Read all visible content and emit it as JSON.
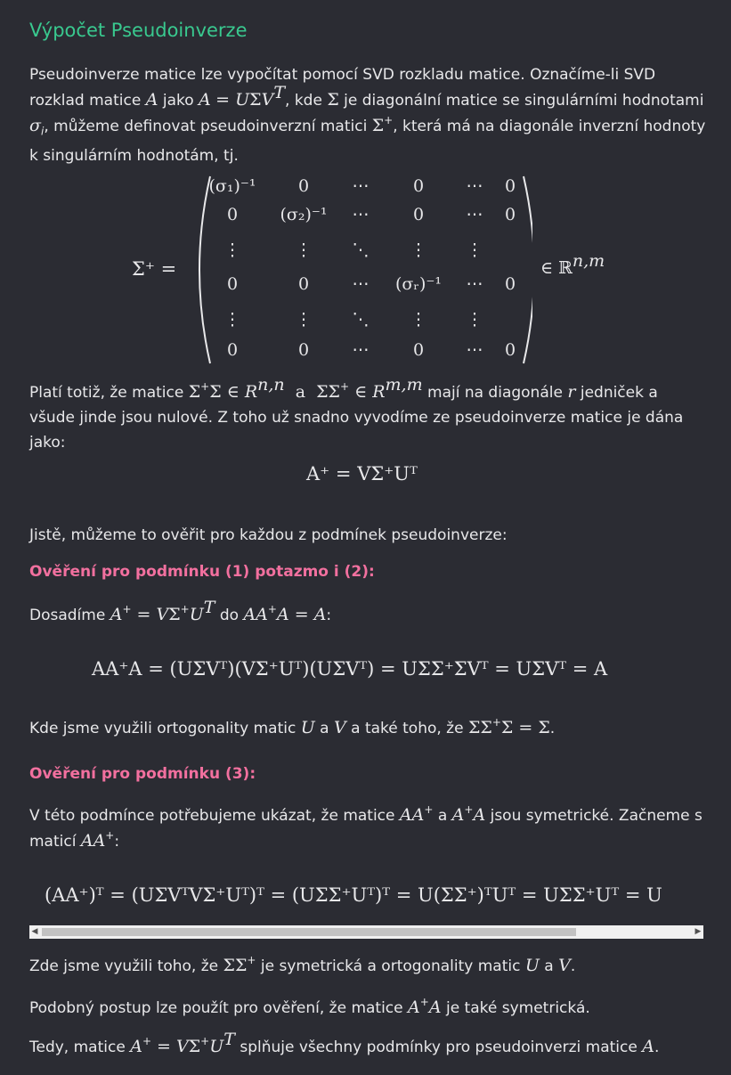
{
  "title": "Výpočet Pseudoinverze",
  "intro": {
    "t1": "Pseudoinverze matice lze vypočítat pomocí SVD rozkladu matice. Označíme-li SVD rozklad matice ",
    "t2": " jako ",
    "t3": ", kde ",
    "t4": " je diagonální matice se singulárními hodnotami ",
    "t5": ", můžeme definovat pseudoinverzní matici ",
    "t6": ", která má na diagonále inverzní hodnoty k singulárním hodnotám, tj."
  },
  "matrix": {
    "lhs": "Σ⁺ =",
    "rhs": "∈ ℝ",
    "rhs_sup": "n,m",
    "rows": [
      [
        "(σ₁)⁻¹",
        "0",
        "⋯",
        "0",
        "⋯",
        "0"
      ],
      [
        "0",
        "(σ₂)⁻¹",
        "⋯",
        "0",
        "⋯",
        "0"
      ],
      [
        "⋮",
        "⋮",
        "⋱",
        "⋮",
        "⋮",
        ""
      ],
      [
        "0",
        "0",
        "⋯",
        "(σᵣ)⁻¹",
        "⋯",
        "0"
      ],
      [
        "⋮",
        "⋮",
        "⋱",
        "⋮",
        "⋮",
        ""
      ],
      [
        "0",
        "0",
        "⋯",
        "0",
        "⋯",
        "0"
      ]
    ]
  },
  "plati": {
    "t1": "Platí totiž, že matice ",
    "t2": " mají na diagonále ",
    "t3": " jedniček a všude jinde jsou nulové. Z toho už snadno vyvodíme ze pseudoinverze matice je dána jako:"
  },
  "eq_main": "A⁺ = VΣ⁺Uᵀ",
  "overit": "Jistě, můžeme to ověřit pro každou z podmínek pseudoinverze:",
  "h1": "Ověření pro podmínku (1) potazmo i (2):",
  "dosadime": {
    "t1": "Dosadíme ",
    "t2": " do "
  },
  "eq2": "AA⁺A = (UΣVᵀ)(VΣ⁺Uᵀ)(UΣVᵀ) = UΣΣ⁺ΣVᵀ = UΣVᵀ = A",
  "kde": {
    "t1": "Kde jsme využili ortogonality matic ",
    "t2": " a ",
    "t3": " a také toho, že "
  },
  "h2": "Ověření pro podmínku (3):",
  "vteto": {
    "t1": "V této podmínce potřebujeme ukázat, že matice ",
    "t2": " a ",
    "t3": " jsou symetrické. Začneme s maticí "
  },
  "eq3": "(AA⁺)ᵀ = (UΣVᵀVΣ⁺Uᵀ)ᵀ = (UΣΣ⁺Uᵀ)ᵀ = U(ΣΣ⁺)ᵀUᵀ = UΣΣ⁺Uᵀ = U",
  "zde": {
    "t1": "Zde jsme využili toho, že ",
    "t2": " je symetrická a ortogonality matic ",
    "t3": " a "
  },
  "podobny": {
    "t1": "Podobný postup lze použít pro ověření, že matice ",
    "t2": " je také symetrická."
  },
  "tedy": {
    "t1": "Tedy, matice ",
    "t2": " splňuje všechny podmínky pro pseudoinverzi matice "
  },
  "colors": {
    "background": "#2b2c33",
    "title": "#39c98f",
    "heading": "#f2709f",
    "text": "#e8e8ea"
  }
}
